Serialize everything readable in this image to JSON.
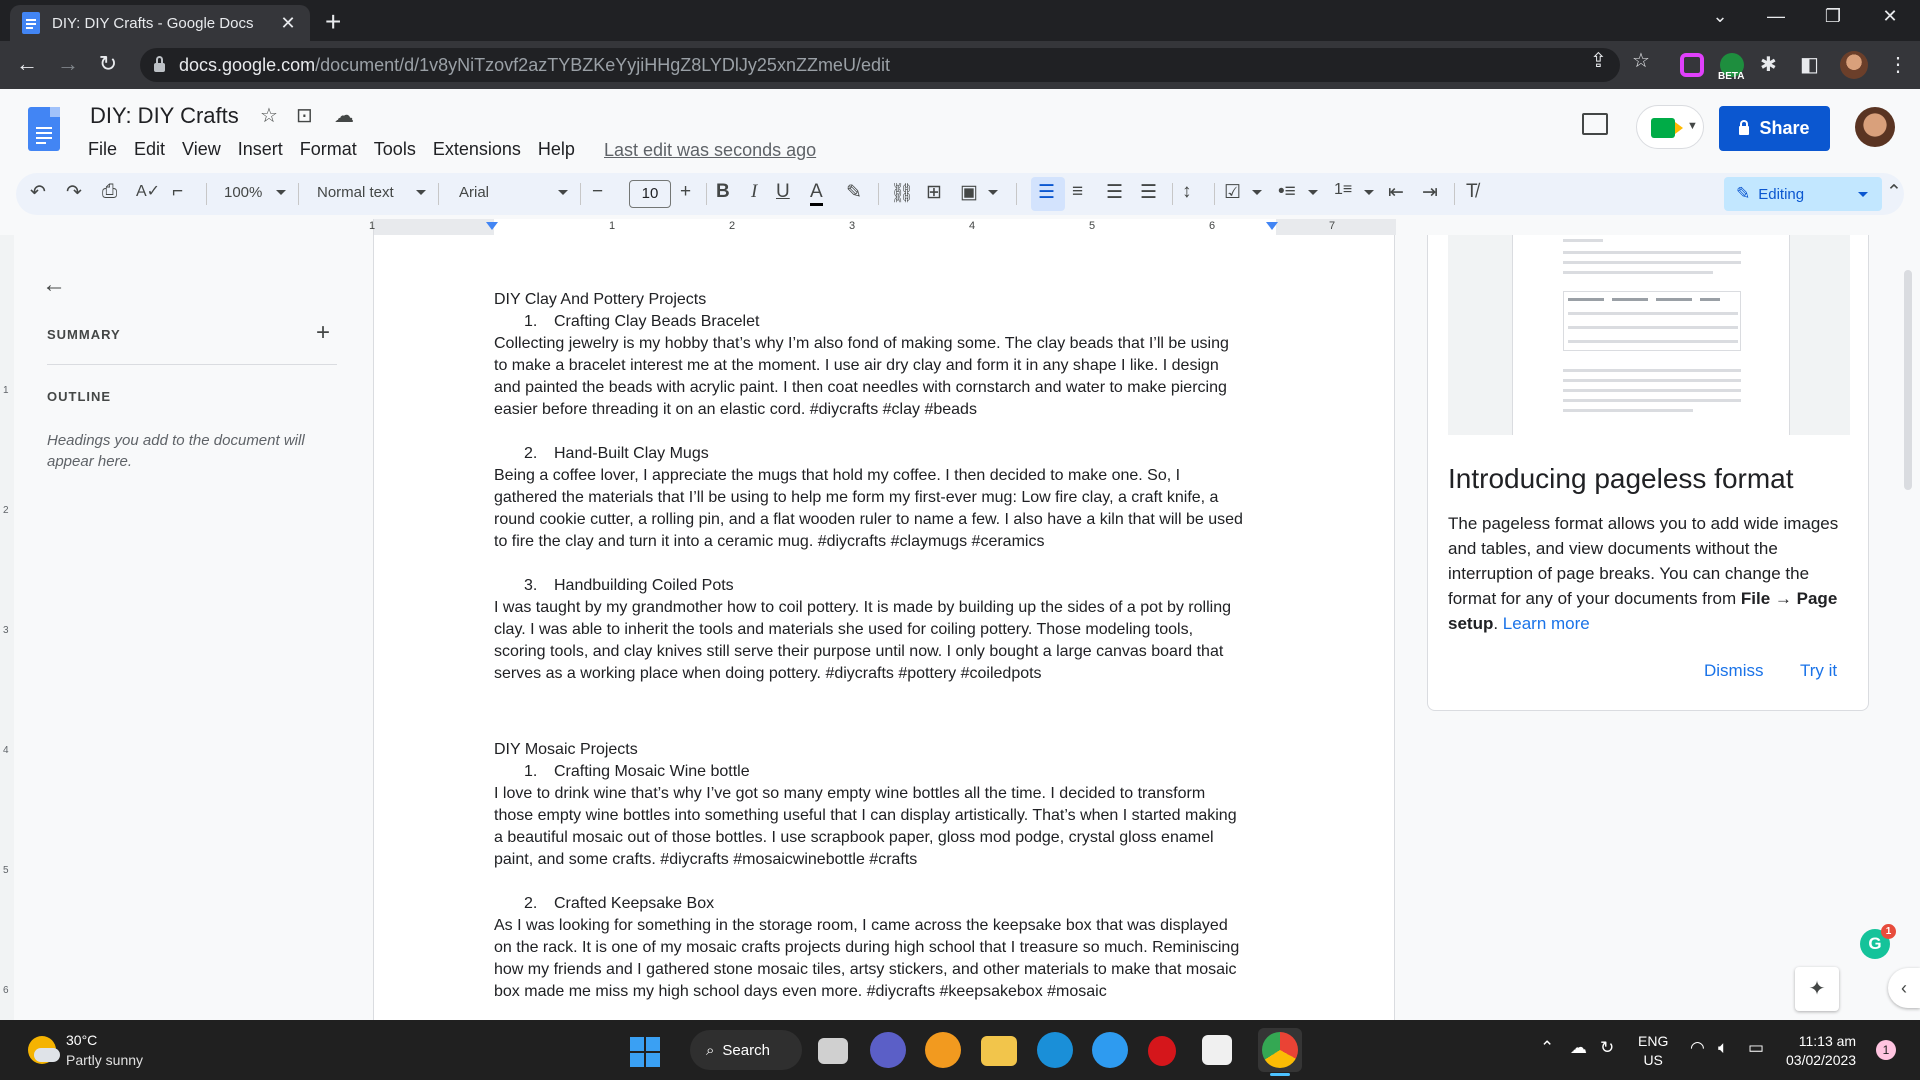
{
  "browser": {
    "tab_title": "DIY: DIY Crafts - Google Docs",
    "url_host": "docs.google.com",
    "url_path": "/document/d/1v8yNiTzovf2azTYBZKeYyjiHHgZ8LYDlJy25xnZZmeU/edit",
    "beta_label": "BETA"
  },
  "docs": {
    "title": "DIY: DIY Crafts",
    "menu": [
      "File",
      "Edit",
      "View",
      "Insert",
      "Format",
      "Tools",
      "Extensions",
      "Help"
    ],
    "last_edit": "Last edit was seconds ago",
    "share_label": "Share"
  },
  "toolbar": {
    "zoom": "100%",
    "style": "Normal text",
    "font": "Arial",
    "font_size": "10",
    "mode": "Editing"
  },
  "ruler": {
    "numbers": [
      "1",
      "1",
      "2",
      "3",
      "4",
      "5",
      "6",
      "7"
    ]
  },
  "vruler": {
    "numbers": [
      "1",
      "2",
      "3",
      "4",
      "5",
      "6"
    ]
  },
  "outline_panel": {
    "summary_label": "SUMMARY",
    "outline_label": "OUTLINE",
    "hint": "Headings you add to the document will appear here."
  },
  "document": {
    "h1": "DIY Clay And Pottery Projects",
    "item1_num": "1.",
    "item1": "Crafting Clay Beads Bracelet",
    "para1_l1": "Collecting jewelry is my hobby that’s why I’m also fond of making some. The clay beads that I’ll be using",
    "para1_l2": "to make a bracelet interest me at the moment. I use air dry clay and form it in any shape I like. I design",
    "para1_l3": "and painted the beads with acrylic paint. I then coat needles with cornstarch and water to make piercing",
    "para1_l4": "easier before threading it on an elastic cord. #diycrafts #clay #beads",
    "item2_num": "2.",
    "item2": "Hand-Built Clay Mugs",
    "para2_l1": "Being a coffee lover, I appreciate the mugs that hold my coffee. I then decided to make one. So, I",
    "para2_l2": "gathered the materials that I’ll be using to help me form my first-ever mug: Low fire clay, a craft knife, a",
    "para2_l3": "round cookie cutter, a rolling pin, and a flat wooden ruler to name a few. I also have a kiln that will be used",
    "para2_l4": "to fire the clay and turn it into a ceramic mug. #diycrafts #claymugs #ceramics",
    "item3_num": "3.",
    "item3": "Handbuilding Coiled Pots",
    "para3_l1": "I was taught by my grandmother how to coil pottery. It is made by building up the sides of a pot by rolling",
    "para3_l2": "clay. I was able to inherit the tools and materials she used for coiling pottery. Those modeling tools,",
    "para3_l3": "scoring tools, and clay knives still serve their purpose until now. I only bought a large canvas board that",
    "para3_l4": "serves as a working place when doing pottery. #diycrafts #pottery #coiledpots",
    "h2": "DIY Mosaic Projects",
    "item4_num": "1.",
    "item4": "Crafting Mosaic Wine bottle",
    "para4_l1": "I love to drink wine that’s why I’ve got so many empty wine bottles all the time. I decided to transform",
    "para4_l2": "those empty wine bottles into something useful that I can display artistically. That’s when I started making",
    "para4_l3": "a beautiful mosaic out of those bottles. I use scrapbook paper, gloss mod podge, crystal gloss enamel",
    "para4_l4": "paint, and some crafts. #diycrafts #mosaicwinebottle #crafts",
    "item5_num": "2.",
    "item5": "Crafted Keepsake Box",
    "para5_l1": "As I was looking for something in the storage room, I came across the keepsake box that was displayed",
    "para5_l2": "on the rack. It is one of my mosaic crafts projects during high school that I treasure so much. Reminiscing",
    "para5_l3": "how my friends and I gathered stone mosaic tiles, artsy stickers, and other materials to make that mosaic",
    "para5_l4": "box made me miss my high school days even more. #diycrafts #keepsakebox #mosaic"
  },
  "promo": {
    "title": "Introducing pageless format",
    "text_a": "The pageless format allows you to add wide images and tables, and view documents without the interruption of page breaks. You can change the format for any of your documents from ",
    "text_bold1": "File → Page setup",
    "text_b": ". ",
    "learn_more": "Learn more",
    "dismiss": "Dismiss",
    "try_it": "Try it"
  },
  "grammarly_badge": "1",
  "taskbar": {
    "temperature": "30°C",
    "condition": "Partly sunny",
    "search": "Search",
    "lang_1": "ENG",
    "lang_2": "US",
    "time": "11:13 am",
    "date": "03/02/2023",
    "notifications": "1"
  },
  "colors": {
    "accent": "#0b57d0",
    "link": "#1a73e8",
    "docs_blue": "#4285f4"
  }
}
